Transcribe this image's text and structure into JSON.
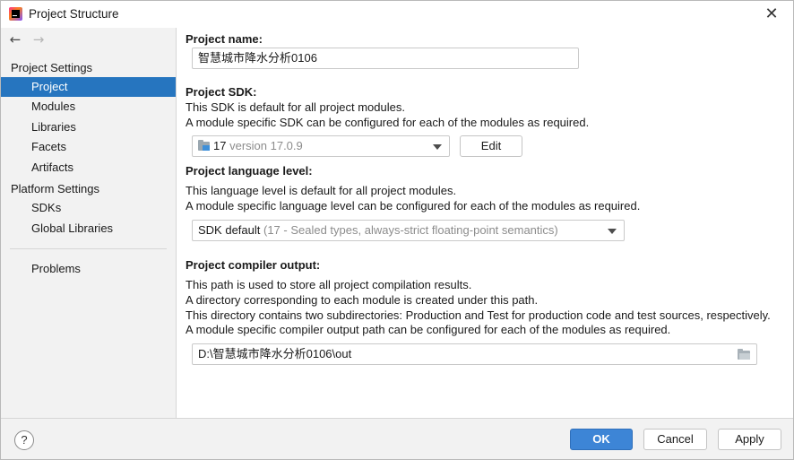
{
  "window": {
    "title": "Project Structure",
    "close_glyph": "✕"
  },
  "nav": {
    "back_glyph": "←",
    "forward_glyph": "→"
  },
  "sidebar": {
    "sections": [
      {
        "label": "Project Settings"
      },
      {
        "label": "Platform Settings"
      }
    ],
    "items": [
      {
        "label": "Project",
        "selected": true
      },
      {
        "label": "Modules"
      },
      {
        "label": "Libraries"
      },
      {
        "label": "Facets"
      },
      {
        "label": "Artifacts"
      },
      {
        "label": "SDKs"
      },
      {
        "label": "Global Libraries"
      },
      {
        "label": "Problems"
      }
    ]
  },
  "main": {
    "project_name": {
      "label": "Project name:",
      "value": "智慧城市降水分析0106"
    },
    "project_sdk": {
      "label": "Project SDK:",
      "desc1": "This SDK is default for all project modules.",
      "desc2": "A module specific SDK can be configured for each of the modules as required.",
      "sdk_name": "17",
      "sdk_version": "version 17.0.9",
      "icon": "folder-icon",
      "edit_label": "Edit"
    },
    "language_level": {
      "label": "Project language level:",
      "desc1": "This language level is default for all project modules.",
      "desc2": "A module specific language level can be configured for each of the modules as required.",
      "value": "SDK default",
      "detail": "(17 - Sealed types, always-strict floating-point semantics)"
    },
    "compiler_output": {
      "label": "Project compiler output:",
      "desc1": "This path is used to store all project compilation results.",
      "desc2": "A directory corresponding to each module is created under this path.",
      "desc3": "This directory contains two subdirectories: Production and Test for production code and test sources, respectively.",
      "desc4": "A module specific compiler output path can be configured for each of the modules as required.",
      "value": "D:\\智慧城市降水分析0106\\out",
      "browse_icon": "folder-open-icon"
    }
  },
  "footer": {
    "help_label": "?",
    "ok_label": "OK",
    "cancel_label": "Cancel",
    "apply_label": "Apply"
  },
  "colors": {
    "selection": "#2675bf",
    "ok_button": "#3d85d6",
    "sidebar_bg": "#f2f2f2"
  }
}
